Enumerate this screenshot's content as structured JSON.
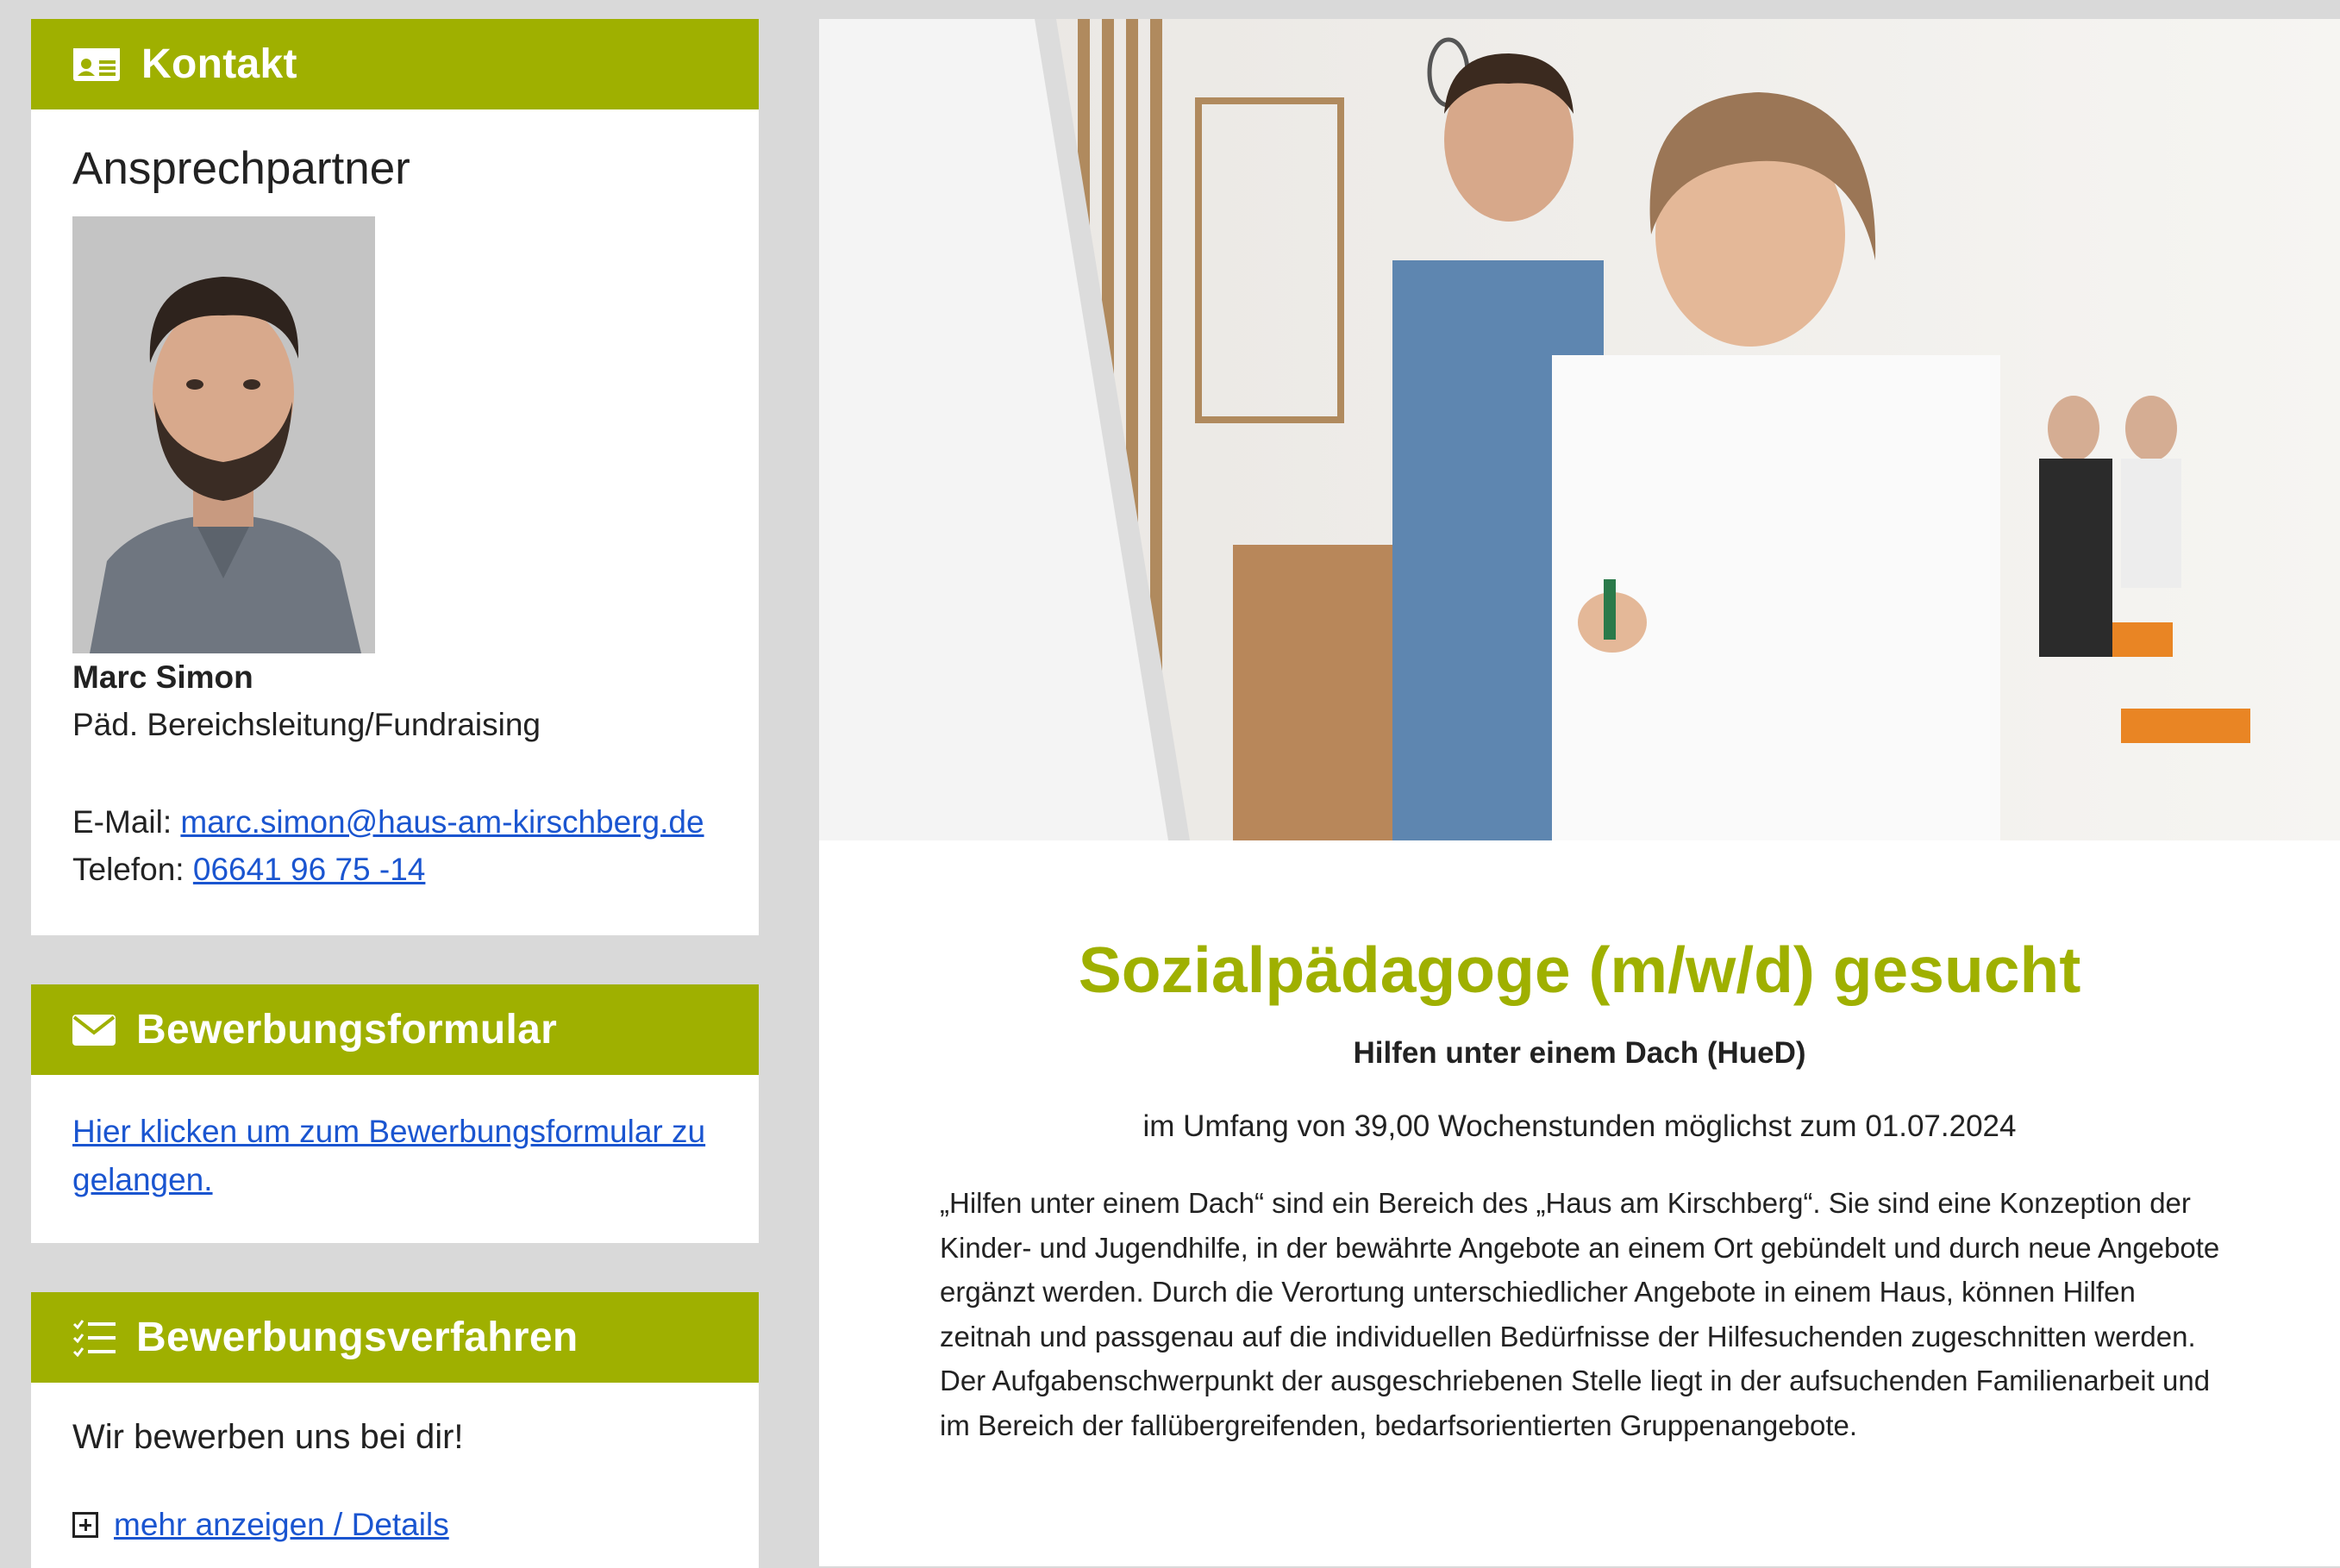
{
  "kontakt": {
    "header": "Kontakt",
    "subheading": "Ansprechpartner",
    "name": "Marc Simon",
    "role": "Päd. Bereichsleitung/Fundraising",
    "email_label": "E-Mail: ",
    "email": "marc.simon@haus-am-kirschberg.de",
    "phone_label": "Telefon: ",
    "phone": "06641 96 75 -14"
  },
  "formular": {
    "header": "Bewerbungsformular",
    "link": "Hier klicken um zum Bewerbungsformular zu gelangen."
  },
  "verfahren": {
    "header": "Bewerbungsverfahren",
    "text": "Wir bewerben uns bei dir!",
    "more_link": "mehr anzeigen / Details"
  },
  "job": {
    "title": "Sozialpädagoge (m/w/d) gesucht",
    "department": "Hilfen unter einem Dach (HueD)",
    "scope": "im Umfang von 39,00 Wochenstunden möglichst zum 01.07.2024",
    "paragraph1": "„Hilfen unter einem Dach“ sind ein Bereich des „Haus am Kirschberg“. Sie sind eine Konzeption der Kinder- und Jugendhilfe, in der bewährte Angebote an einem Ort gebündelt und durch neue Angebote ergänzt werden. Durch die Verortung unterschiedlicher Angebote in einem Haus, können Hilfen zeitnah und passgenau auf die individuellen Bedürfnisse der Hilfesuchenden zugeschnitten werden.",
    "paragraph2": "Der Aufgabenschwerpunkt der ausgeschriebenen Stelle liegt in der aufsuchenden Familienarbeit und im Bereich der fallübergreifenden, bedarfsorientierten Gruppenangebote."
  },
  "colors": {
    "accent": "#9fb000",
    "link": "#1a55d0",
    "page_bg": "#d9d9d9"
  },
  "icons": {
    "kontakt": "contact-card-icon",
    "formular": "envelope-icon",
    "verfahren": "checklist-icon",
    "more": "plus-square-icon"
  }
}
